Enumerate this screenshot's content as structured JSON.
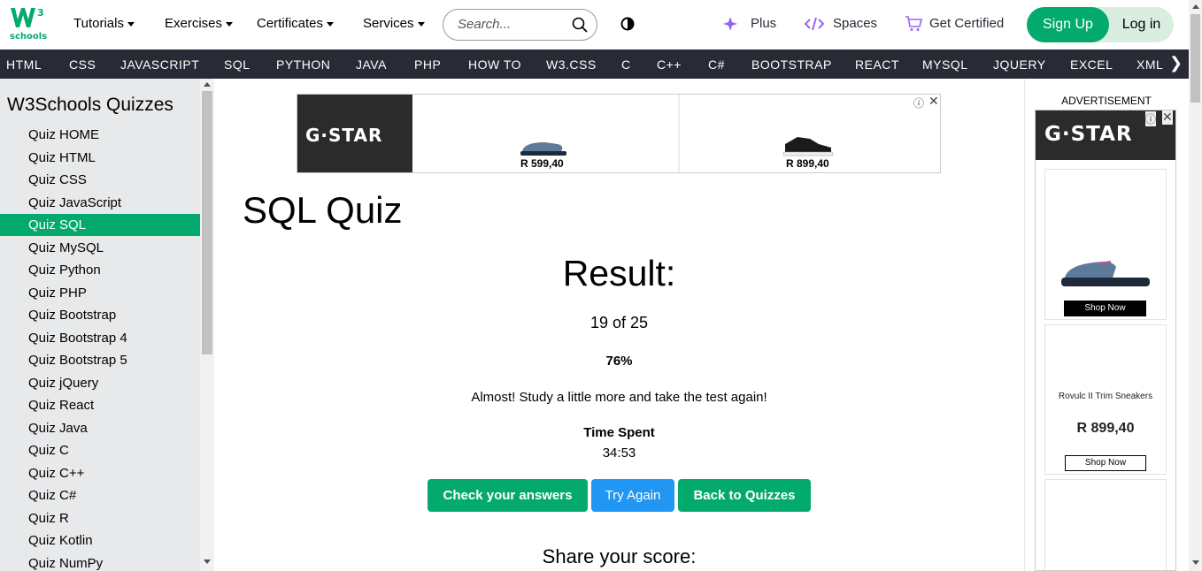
{
  "header": {
    "logo_text": "schools",
    "logo_superscript": "3",
    "menus": [
      "Tutorials",
      "Exercises",
      "Certificates",
      "Services"
    ],
    "search_placeholder": "Search...",
    "plus_label": "Plus",
    "spaces_label": "Spaces",
    "get_certified_label": "Get Certified",
    "signup_label": "Sign Up",
    "login_label": "Log in",
    "brand_color": "#04AA6D"
  },
  "subnav": {
    "items": [
      "HTML",
      "CSS",
      "JAVASCRIPT",
      "SQL",
      "PYTHON",
      "JAVA",
      "PHP",
      "HOW TO",
      "W3.CSS",
      "C",
      "C++",
      "C#",
      "BOOTSTRAP",
      "REACT",
      "MYSQL",
      "JQUERY",
      "EXCEL",
      "XML"
    ],
    "next_icon": "chevron-right-icon"
  },
  "sidebar": {
    "title": "W3Schools Quizzes",
    "items": [
      {
        "label": "Quiz HOME",
        "active": false
      },
      {
        "label": "Quiz HTML",
        "active": false
      },
      {
        "label": "Quiz CSS",
        "active": false
      },
      {
        "label": "Quiz JavaScript",
        "active": false
      },
      {
        "label": "Quiz SQL",
        "active": true
      },
      {
        "label": "Quiz MySQL",
        "active": false
      },
      {
        "label": "Quiz Python",
        "active": false
      },
      {
        "label": "Quiz PHP",
        "active": false
      },
      {
        "label": "Quiz Bootstrap",
        "active": false
      },
      {
        "label": "Quiz Bootstrap 4",
        "active": false
      },
      {
        "label": "Quiz Bootstrap 5",
        "active": false
      },
      {
        "label": "Quiz jQuery",
        "active": false
      },
      {
        "label": "Quiz React",
        "active": false
      },
      {
        "label": "Quiz Java",
        "active": false
      },
      {
        "label": "Quiz C",
        "active": false
      },
      {
        "label": "Quiz C++",
        "active": false
      },
      {
        "label": "Quiz C#",
        "active": false
      },
      {
        "label": "Quiz R",
        "active": false
      },
      {
        "label": "Quiz Kotlin",
        "active": false
      },
      {
        "label": "Quiz NumPy",
        "active": false
      }
    ]
  },
  "ad_top": {
    "brand": "G·STAR",
    "price_1": "R 599,40",
    "price_2": "R 899,40"
  },
  "main": {
    "title": "SQL Quiz",
    "result_heading": "Result:",
    "score": "19 of 25",
    "percent": "76%",
    "message": "Almost! Study a little more and take the test again!",
    "time_label": "Time Spent",
    "time_value": "34:53",
    "buttons": {
      "check": "Check your answers",
      "try_again": "Try Again",
      "back": "Back to Quizzes"
    },
    "share_heading": "Share your score:"
  },
  "ad_right": {
    "label": "ADVERTISEMENT",
    "brand": "G·STAR",
    "shop_now_1": "Shop Now",
    "product_name": "Rovulc II Trim Sneakers",
    "product_price": "R 899,40",
    "shop_now_2": "Shop Now"
  }
}
